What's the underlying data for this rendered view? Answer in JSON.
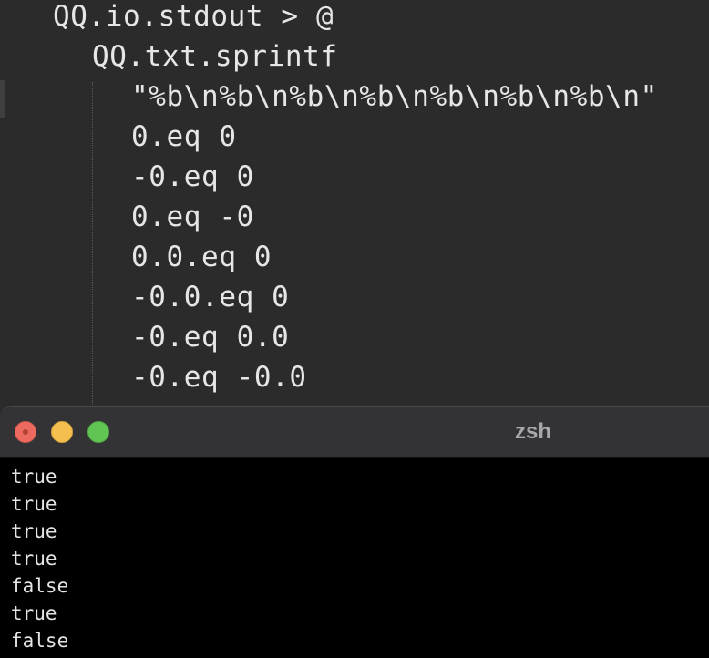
{
  "editor": {
    "code_lines": [
      "QQ.io.stdout > @",
      "QQ.txt.sprintf",
      "\"%b\\n%b\\n%b\\n%b\\n%b\\n%b\\n%b\\n\"",
      "0.eq 0",
      "-0.eq 0",
      "0.eq -0",
      "0.0.eq 0",
      "-0.0.eq 0",
      "-0.eq 0.0",
      "-0.eq -0.0"
    ]
  },
  "terminal": {
    "title": "zsh",
    "output_lines": [
      "true",
      "true",
      "true",
      "true",
      "false",
      "true",
      "false"
    ],
    "prompt": ""
  },
  "colors": {
    "editor_background": "#2b2b2b",
    "code_text": "#e6e6e6",
    "terminal_background": "#000000",
    "titlebar": "#333336",
    "close_light": "#ec6a5e",
    "minimize_light": "#f4bf4f",
    "zoom_light": "#61c554"
  },
  "icons": {
    "close": "close-icon",
    "minimize": "minimize-icon",
    "zoom": "zoom-icon",
    "cursor": "cursor-block"
  }
}
